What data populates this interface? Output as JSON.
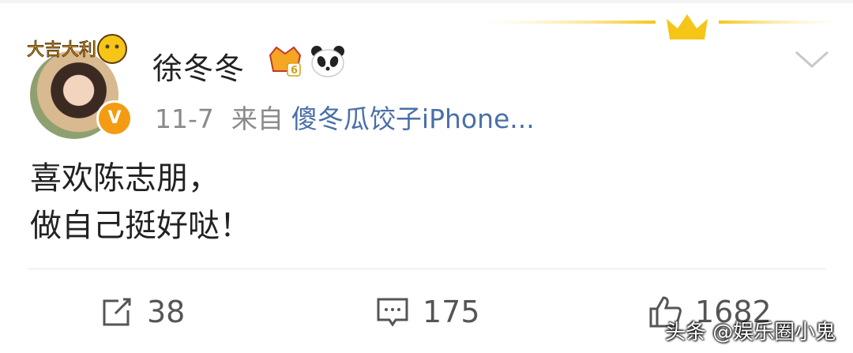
{
  "post": {
    "username": "徐冬冬",
    "date": "11-7",
    "source_label": "来自",
    "source": "傻冬瓜饺子iPhone...",
    "text_lines": [
      "喜欢陈志朋，",
      "做自己挺好哒！"
    ],
    "verified_mark": "V",
    "avatar_sticker_text": "大吉大利",
    "vip_level": "6"
  },
  "actions": {
    "repost_count": "38",
    "comment_count": "175",
    "like_count": "1682"
  },
  "watermark": "头条 @娱乐圈小鬼",
  "icons": {
    "crown": "crown-icon",
    "vip": "vip-crown-icon",
    "panda": "panda-icon",
    "chevron": "chevron-down-icon",
    "repost": "repost-icon",
    "comment": "comment-icon",
    "like": "like-icon"
  },
  "colors": {
    "link": "#4a6fa8",
    "meta": "#8a8a8a",
    "badge": "#f39c12",
    "crown": "#f5c518"
  }
}
